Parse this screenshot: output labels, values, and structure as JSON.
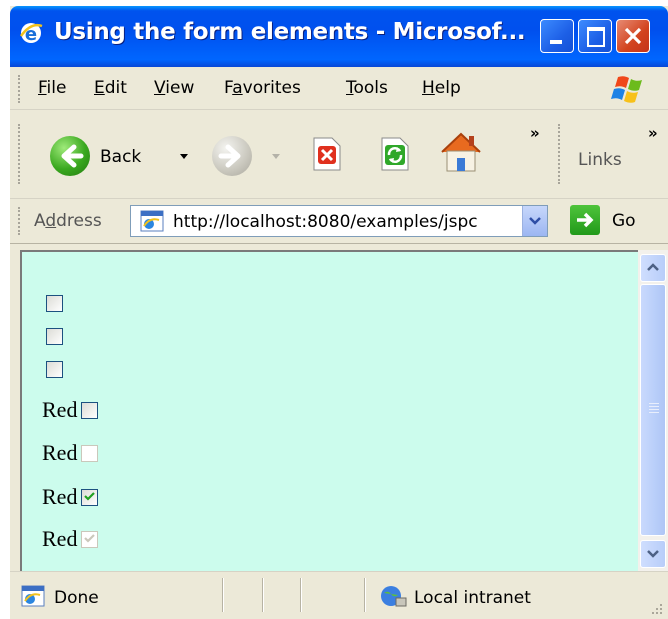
{
  "window": {
    "title": "Using the form elements - Microsof..."
  },
  "menu": {
    "items": [
      {
        "label": "File",
        "accel": "F",
        "rest": "ile"
      },
      {
        "label": "Edit",
        "accel": "E",
        "rest": "dit"
      },
      {
        "label": "View",
        "accel": "V",
        "rest": "iew"
      },
      {
        "label": "Favorites",
        "pre": "F",
        "accel": "a",
        "rest": "vorites"
      },
      {
        "label": "Tools",
        "accel": "T",
        "rest": "ools"
      },
      {
        "label": "Help",
        "accel": "H",
        "rest": "elp"
      }
    ]
  },
  "toolbar": {
    "back_label": "Back",
    "links_label": "Links",
    "overflow": "»"
  },
  "address": {
    "label": "Address",
    "label_accel": "d",
    "url": "http://localhost:8080/examples/jspc",
    "go_label": "Go"
  },
  "content": {
    "checkboxes": [
      {
        "label": "",
        "checked": false,
        "disabled": false
      },
      {
        "label": "",
        "checked": false,
        "disabled": false
      },
      {
        "label": "",
        "checked": false,
        "disabled": false
      },
      {
        "label": "Red",
        "checked": false,
        "disabled": false
      },
      {
        "label": "Red",
        "checked": false,
        "disabled": true
      },
      {
        "label": "Red",
        "checked": true,
        "disabled": false
      },
      {
        "label": "Red",
        "checked": true,
        "disabled": true
      }
    ]
  },
  "status": {
    "text": "Done",
    "zone": "Local intranet"
  },
  "colors": {
    "page_background": "#ccfced",
    "title_bar": "#0058ee",
    "check_enabled": "#21a121",
    "check_disabled": "#cac8bb"
  }
}
